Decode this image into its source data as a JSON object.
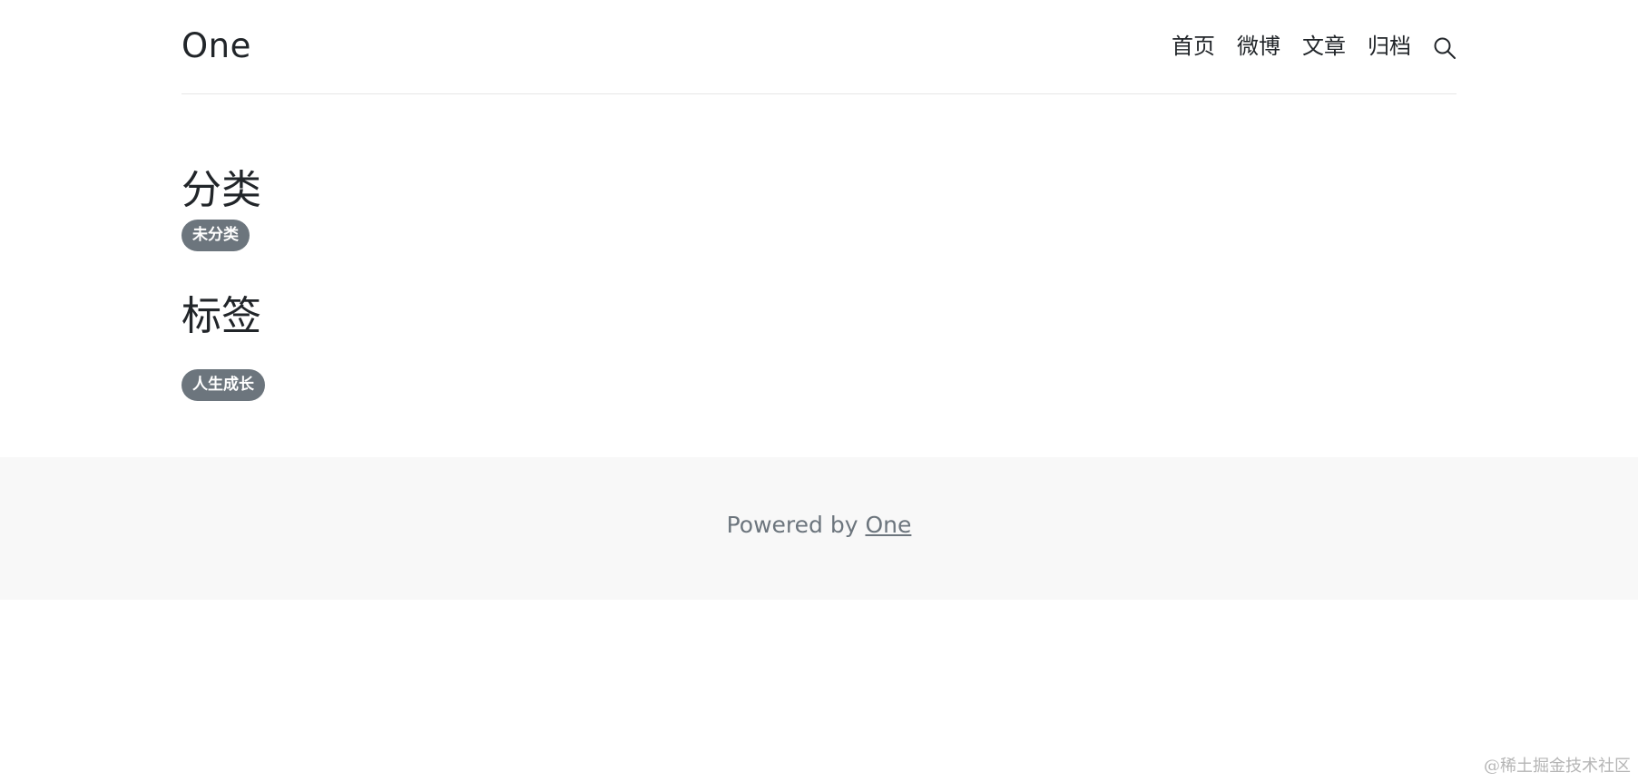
{
  "header": {
    "brand": "One",
    "nav": [
      {
        "label": "首页"
      },
      {
        "label": "微博"
      },
      {
        "label": "文章"
      },
      {
        "label": "归档"
      }
    ],
    "search_icon": "search-icon"
  },
  "main": {
    "categories": {
      "title": "分类",
      "items": [
        {
          "label": "未分类"
        }
      ]
    },
    "tags": {
      "title": "标签",
      "items": [
        {
          "label": "人生成长"
        }
      ]
    }
  },
  "footer": {
    "prefix": "Powered by ",
    "link_label": "One"
  },
  "watermark": "@稀土掘金技术社区",
  "colors": {
    "badge_bg": "#6c757d",
    "footer_bg": "#f8f8f8",
    "text": "#212529",
    "muted": "#6c757d"
  }
}
